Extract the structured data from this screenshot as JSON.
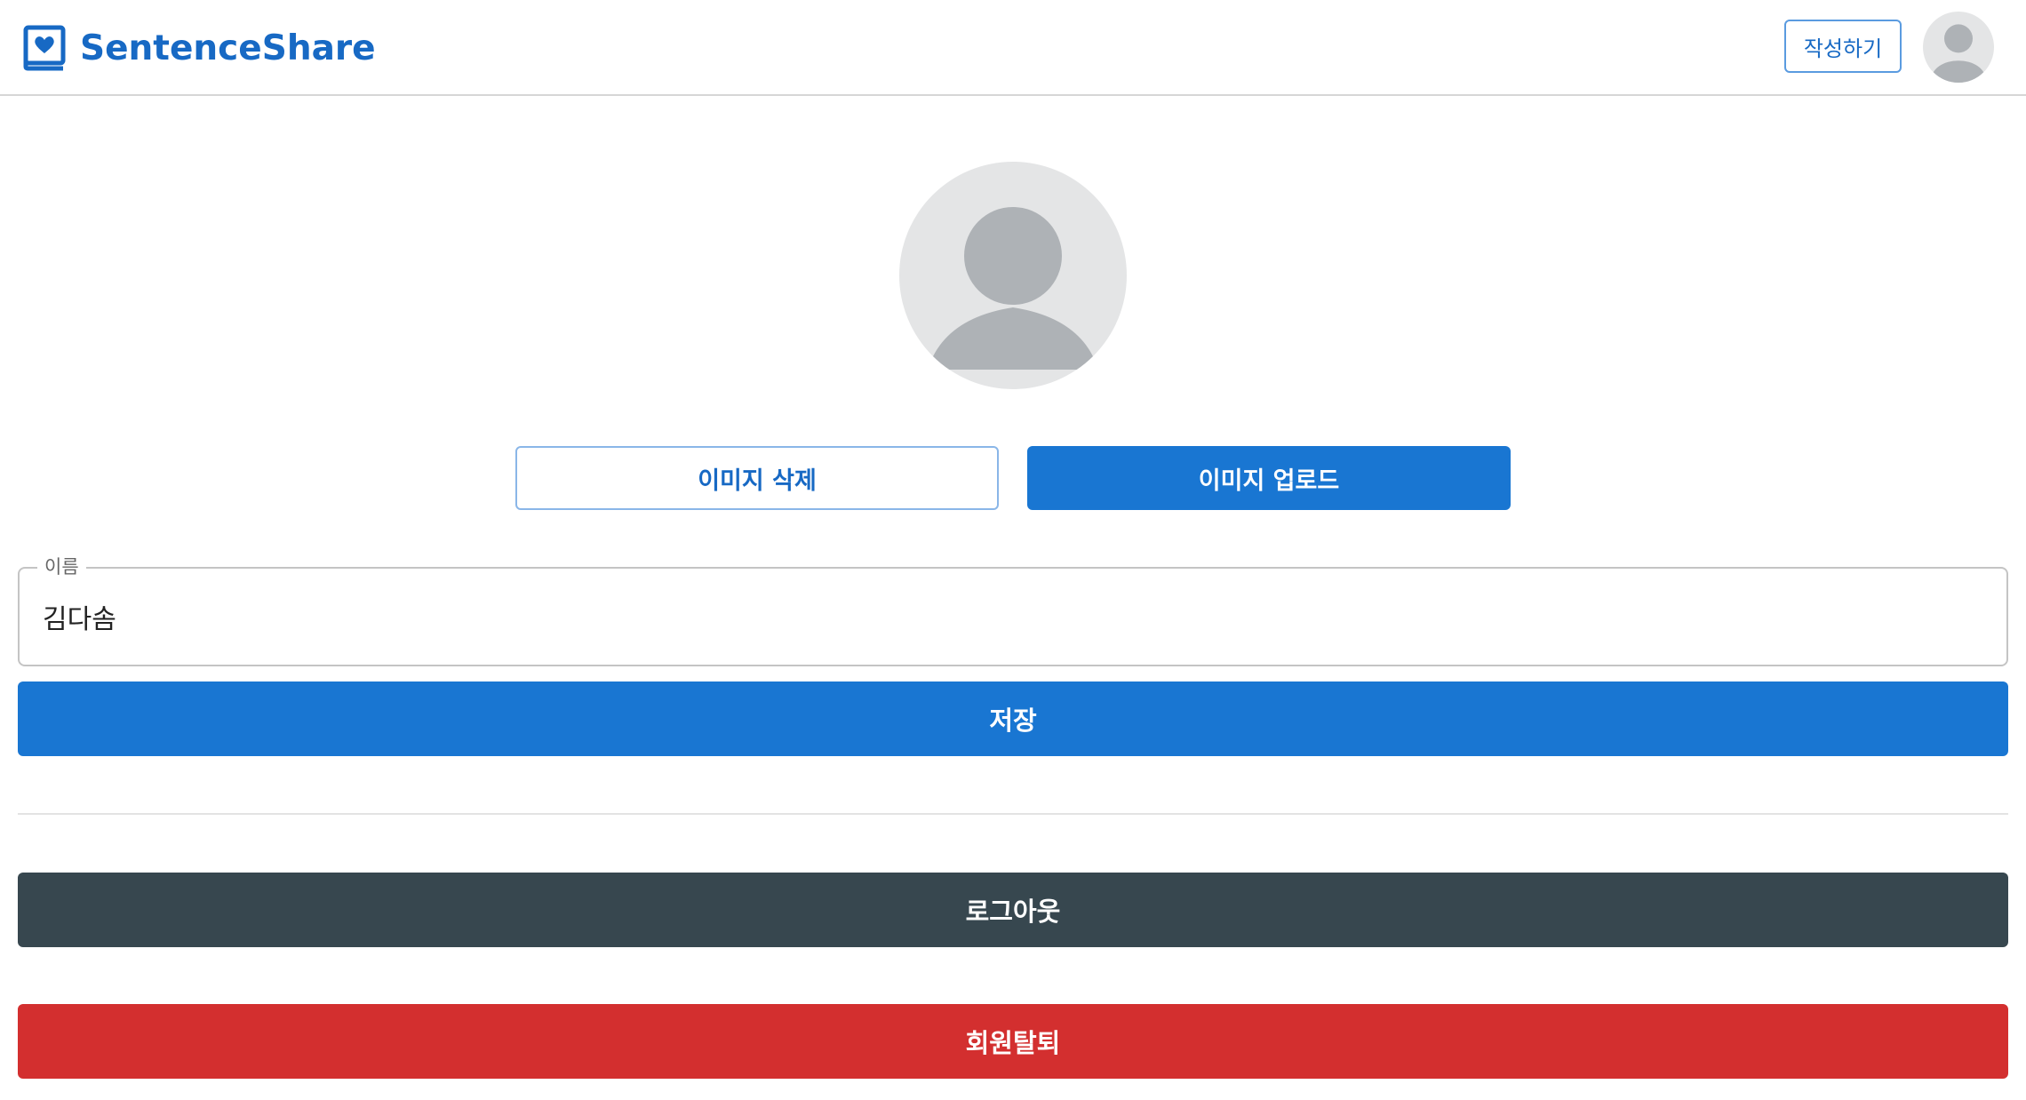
{
  "header": {
    "brand_name": "SentenceShare",
    "write_button": "작성하기"
  },
  "profile": {
    "delete_image_button": "이미지 삭제",
    "upload_image_button": "이미지 업로드"
  },
  "form": {
    "name_label": "이름",
    "name_value": "김다솜",
    "save_button": "저장"
  },
  "account": {
    "logout_button": "로그아웃",
    "withdraw_button": "회원탈퇴"
  },
  "colors": {
    "brand": "#1769c4",
    "primary": "#1976d2",
    "logout": "#37474f",
    "danger": "#d32f2f",
    "avatar_bg": "#e4e5e6",
    "avatar_fg": "#aeb2b6"
  }
}
